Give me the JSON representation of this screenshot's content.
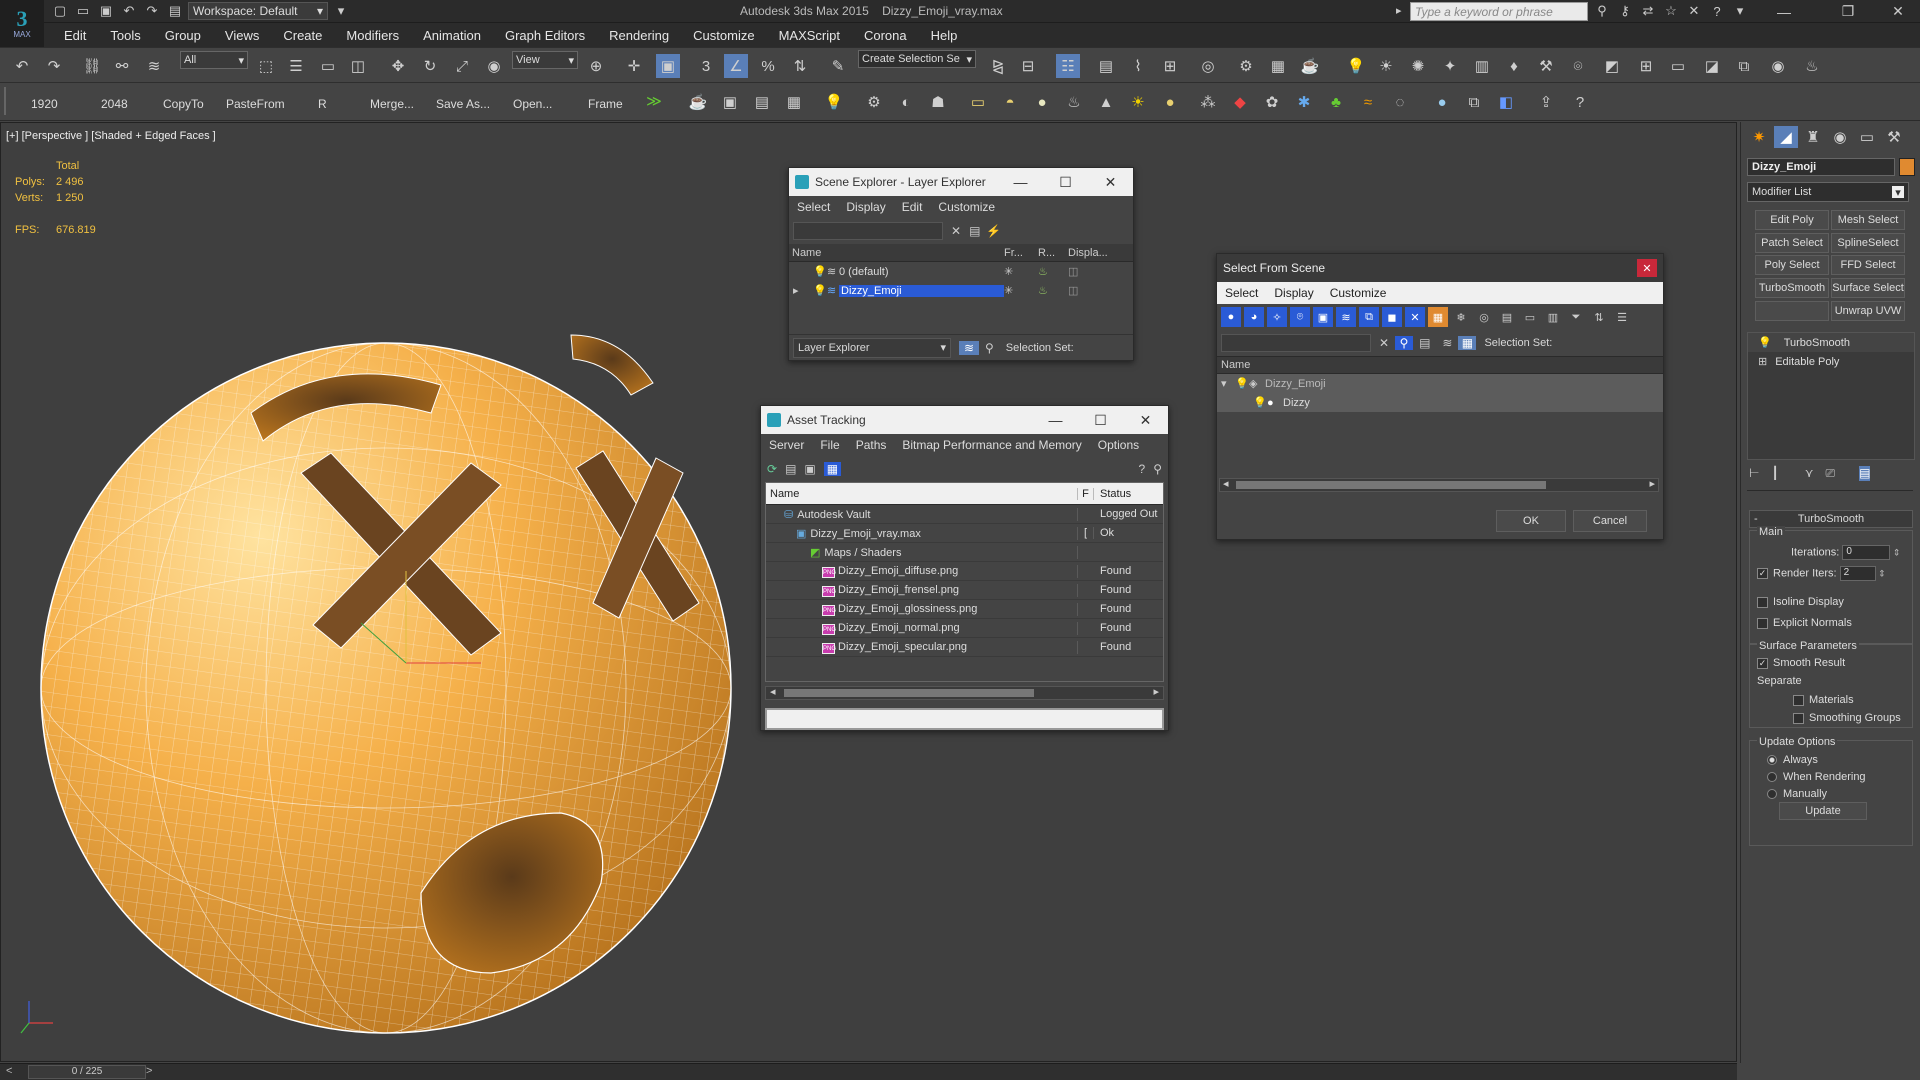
{
  "app": {
    "title": "Autodesk 3ds Max 2015",
    "file": "Dizzy_Emoji_vray.max",
    "logo": "MAX",
    "workspace": "Workspace: Default",
    "search_placeholder": "Type a keyword or phrase"
  },
  "menu": [
    "Edit",
    "Tools",
    "Group",
    "Views",
    "Create",
    "Modifiers",
    "Animation",
    "Graph Editors",
    "Rendering",
    "Customize",
    "MAXScript",
    "Corona",
    "Help"
  ],
  "toolbar1": {
    "filter": "All",
    "refcoord": "View",
    "selection_set_placeholder": "Create Selection Se"
  },
  "toolbar2": {
    "labels": [
      "1920",
      "2048",
      "CopyTo",
      "PasteFrom",
      "R",
      "Merge...",
      "Save As...",
      "Open...",
      "Frame"
    ]
  },
  "viewport": {
    "label": "[+] [Perspective ] [Shaded + Edged Faces ]",
    "stats": {
      "total_label": "Total",
      "polys_label": "Polys:",
      "polys": "2 496",
      "verts_label": "Verts:",
      "verts": "1 250",
      "fps_label": "FPS:",
      "fps": "676.819"
    }
  },
  "timeslider": "0 / 225",
  "scene_explorer": {
    "title": "Scene Explorer - Layer Explorer",
    "menu": [
      "Select",
      "Display",
      "Edit",
      "Customize"
    ],
    "columns": [
      "Name",
      "Fr...",
      "R...",
      "Displa..."
    ],
    "rows": [
      "0 (default)",
      "Dizzy_Emoji"
    ],
    "footer_mode": "Layer Explorer",
    "selection_set": "Selection Set:"
  },
  "asset_tracking": {
    "title": "Asset Tracking",
    "menu": [
      "Server",
      "File",
      "Paths",
      "Bitmap Performance and Memory",
      "Options"
    ],
    "columns": [
      "Name",
      "F",
      "Status"
    ],
    "rows": [
      {
        "name": "Autodesk Vault",
        "f": "",
        "status": "Logged Out"
      },
      {
        "name": "Dizzy_Emoji_vray.max",
        "f": "[",
        "status": "Ok"
      },
      {
        "name": "Maps / Shaders",
        "f": "",
        "status": ""
      },
      {
        "name": "Dizzy_Emoji_diffuse.png",
        "f": "",
        "status": "Found"
      },
      {
        "name": "Dizzy_Emoji_frensel.png",
        "f": "",
        "status": "Found"
      },
      {
        "name": "Dizzy_Emoji_glossiness.png",
        "f": "",
        "status": "Found"
      },
      {
        "name": "Dizzy_Emoji_normal.png",
        "f": "",
        "status": "Found"
      },
      {
        "name": "Dizzy_Emoji_specular.png",
        "f": "",
        "status": "Found"
      }
    ],
    "png_tag": "PNG"
  },
  "select_from_scene": {
    "title": "Select From Scene",
    "menu": [
      "Select",
      "Display",
      "Customize"
    ],
    "selection_set": "Selection Set:",
    "column": "Name",
    "rows": [
      "Dizzy_Emoji",
      "Dizzy"
    ],
    "ok": "OK",
    "cancel": "Cancel"
  },
  "command_panel": {
    "object_name": "Dizzy_Emoji",
    "object_color": "#e08a30",
    "modifier_list": "Modifier List",
    "buttons": [
      "Edit Poly",
      "Mesh Select",
      "Patch Select",
      "SplineSelect",
      "Poly Select",
      "FFD Select",
      "TurboSmooth",
      "Surface Select",
      "Unwrap UVW"
    ],
    "stack": [
      "TurboSmooth",
      "Editable Poly"
    ],
    "rollout": "TurboSmooth",
    "main": "Main",
    "iterations_label": "Iterations:",
    "iterations": "0",
    "render_iters_label": "Render Iters:",
    "render_iters": "2",
    "isoline": "Isoline Display",
    "explicit_normals": "Explicit Normals",
    "surface_params": "Surface Parameters",
    "smooth_result": "Smooth Result",
    "separate": "Separate",
    "materials": "Materials",
    "smoothing_groups": "Smoothing Groups",
    "update_options": "Update Options",
    "always": "Always",
    "when_rendering": "When Rendering",
    "manually": "Manually",
    "update": "Update"
  },
  "colors": {
    "accent": "#2a5bd6",
    "emoji": "#f0a830",
    "viewport_bg": "#3f3f3f"
  }
}
